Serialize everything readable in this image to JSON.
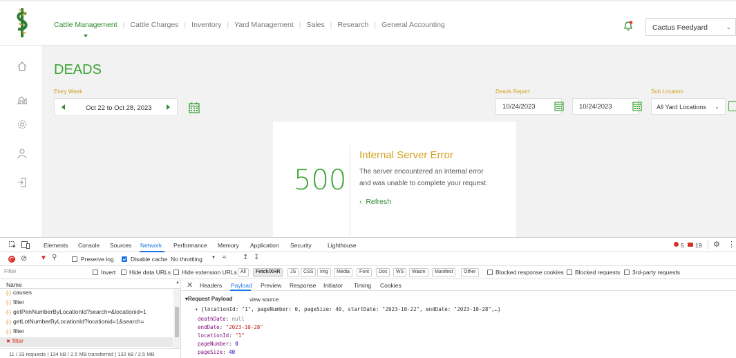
{
  "app": {
    "nav": [
      "Cattle Management",
      "Cattle Charges",
      "Inventory",
      "Yard Management",
      "Sales",
      "Research",
      "General Accounting"
    ],
    "yard_select": "Cactus Feedyard",
    "page_title": "DEADS",
    "entry_week_label": "Entry Week",
    "entry_week_value": "Oct 22 to Oct 28, 2023",
    "deads_report_label": "Deads Report",
    "deads_report_from": "10/24/2023",
    "deads_report_to": "10/24/2023",
    "sub_location_label": "Sub Location",
    "sub_location_value": "All Yard Locations",
    "error": {
      "code": "500",
      "title": "Internal Server Error",
      "line1": "The server encountered an internal error",
      "line2": "and was unable to complete your request.",
      "refresh": "Refresh"
    },
    "colors": {
      "brand_green": "#3aa335",
      "accent_gold": "#d4a020",
      "content_bg": "#f2f2f2"
    }
  },
  "devtools": {
    "tabs": [
      "Elements",
      "Console",
      "Sources",
      "Network",
      "Performance",
      "Memory",
      "Application",
      "Security",
      "Lighthouse"
    ],
    "active_tab": "Network",
    "error_count": "5",
    "warning_count": "19",
    "toolbar": {
      "preserve_log": "Preserve log",
      "disable_cache": "Disable cache",
      "throttling": "No throttling"
    },
    "filter": {
      "placeholder": "Filter",
      "invert": "Invert",
      "hide_data_urls": "Hide data URLs",
      "hide_extension_urls": "Hide extension URLs",
      "types": [
        "All",
        "Fetch/XHR",
        "JS",
        "CSS",
        "Img",
        "Media",
        "Font",
        "Doc",
        "WS",
        "Wasm",
        "Manifest",
        "Other"
      ],
      "selected_type": "Fetch/XHR",
      "blocked_response_cookies": "Blocked response cookies",
      "blocked_requests": "Blocked requests",
      "third_party": "3rd-party requests"
    },
    "requests_header": "Name",
    "requests": [
      {
        "name": "causes",
        "error": false
      },
      {
        "name": "filter",
        "error": false
      },
      {
        "name": "getPenNumberByLocationId?search=&locationid=1",
        "error": false
      },
      {
        "name": "getLotNumberByLocationId?locationid=1&search=",
        "error": false
      },
      {
        "name": "filter",
        "error": false
      },
      {
        "name": "filter",
        "error": true
      }
    ],
    "status_bar": "11 / 33 requests  |  134 kB / 2.5 MB transferred  |  132 kB / 2.5 MB",
    "detail_tabs": [
      "Headers",
      "Payload",
      "Preview",
      "Response",
      "Initiator",
      "Timing",
      "Cookies"
    ],
    "active_detail_tab": "Payload",
    "payload": {
      "section_title": "Request Payload",
      "view_source": "view source",
      "summary": "{locationId: \"1\", pageNumber: 0, pageSize: 40, startDate: \"2023-10-22\", endDate: \"2023-10-28\",…}",
      "fields": [
        {
          "key": "deathDate",
          "value": "null",
          "type": "null"
        },
        {
          "key": "endDate",
          "value": "\"2023-10-28\"",
          "type": "string"
        },
        {
          "key": "locationId",
          "value": "\"1\"",
          "type": "string"
        },
        {
          "key": "pageNumber",
          "value": "0",
          "type": "number"
        },
        {
          "key": "pageSize",
          "value": "40",
          "type": "number"
        }
      ]
    }
  }
}
